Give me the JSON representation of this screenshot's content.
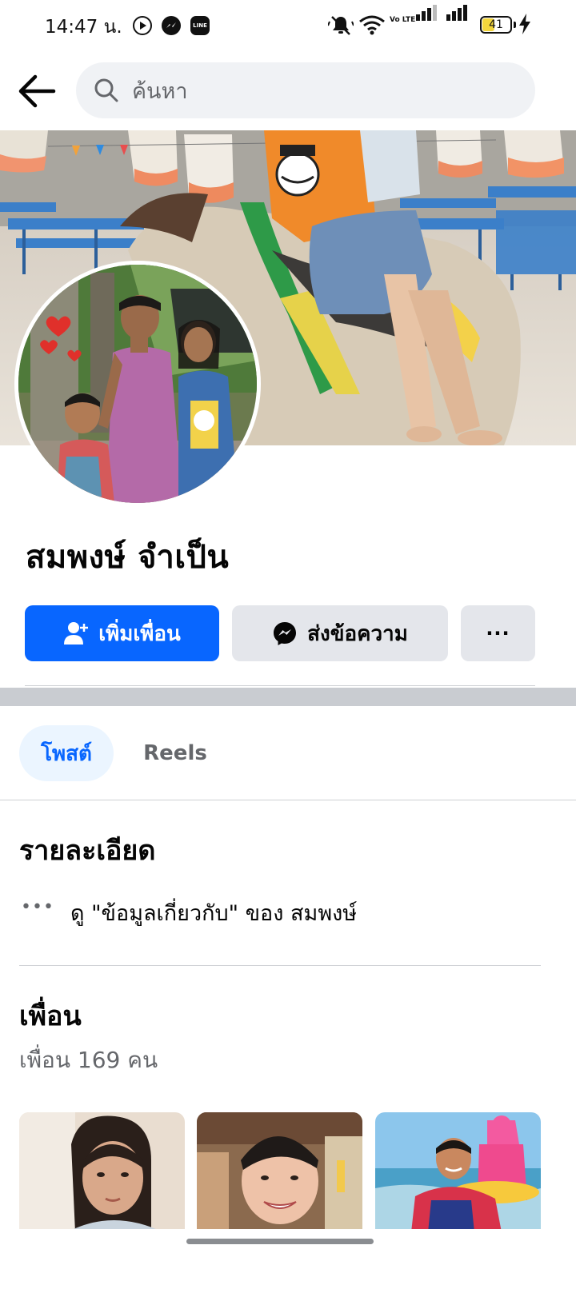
{
  "status_bar": {
    "time": "14:47 น.",
    "battery": "41",
    "battery_level": 0.41,
    "network_label": "Vo LTE"
  },
  "header": {
    "search_placeholder": "ค้นหา"
  },
  "profile": {
    "name": "สมพงษ์ จำเป็น"
  },
  "actions": {
    "add_friend_label": "เพิ่มเพื่อน",
    "message_label": "ส่งข้อความ",
    "more_label": "···"
  },
  "tabs": [
    {
      "label": "โพสต์",
      "active": true
    },
    {
      "label": "Reels",
      "active": false
    }
  ],
  "details": {
    "title": "รายละเอียด",
    "about_dots": "•••",
    "about_link": "ดู \"ข้อมูลเกี่ยวกับ\" ของ สมพงษ์"
  },
  "friends": {
    "title": "เพื่อน",
    "count_label": "เพื่อน 169 คน"
  },
  "colors": {
    "accent": "#0866ff",
    "secondary_button": "#e4e6eb",
    "search_bg": "#f0f2f5"
  }
}
